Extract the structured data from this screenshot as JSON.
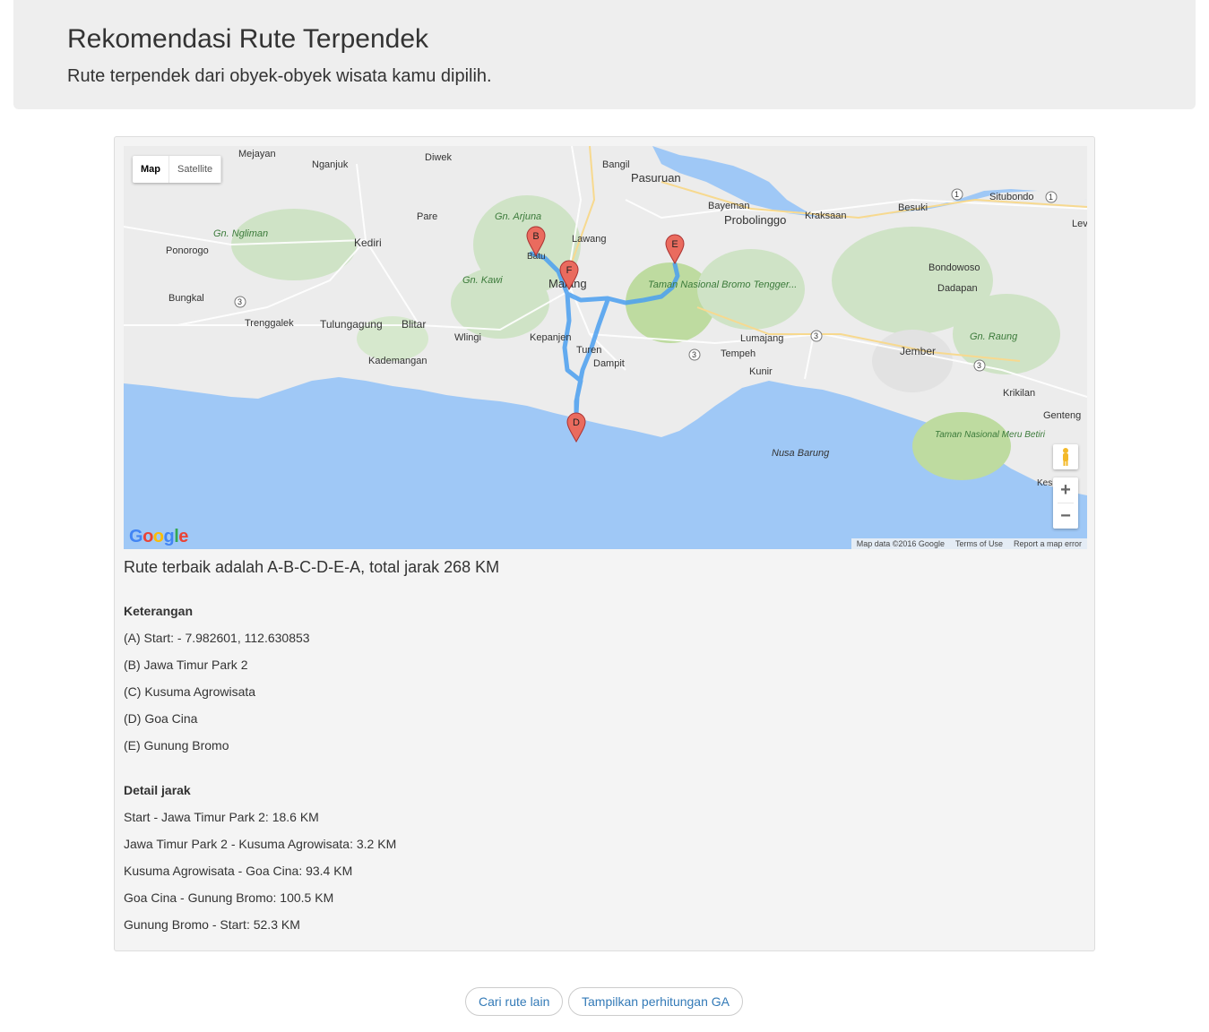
{
  "header": {
    "title": "Rekomendasi Rute Terpendek",
    "subtitle": "Rute terpendek dari obyek-obyek wisata kamu dipilih."
  },
  "map": {
    "type_controls": [
      "Map",
      "Satellite"
    ],
    "active_type": "Map",
    "logo": "Google",
    "attribution": [
      "Map data ©2016 Google",
      "Terms of Use",
      "Report a map error"
    ],
    "markers": [
      "B",
      "F",
      "E",
      "D"
    ],
    "route_color": "#4a9ff0",
    "marker_color": "#ea6b5e",
    "water_color": "#9fc8f6",
    "land_color": "#ececec",
    "places": {
      "mejayan": "Mejayan",
      "nganjuk": "Nganjuk",
      "diwek": "Diwek",
      "bangil": "Bangil",
      "pasuruan": "Pasuruan",
      "situbondo": "Situbondo",
      "bayeman": "Bayeman",
      "probolinggo": "Probolinggo",
      "kraksaan": "Kraksaan",
      "besuki": "Besuki",
      "lev": "Lev",
      "pare": "Pare",
      "arjuna": "Gn. Arjuna",
      "ngliman": "Gn. Ngliman",
      "kediri": "Kediri",
      "ponorogo": "Ponorogo",
      "lawang": "Lawang",
      "batu": "Batu",
      "kawi": "Gn. Kawi",
      "malang": "Malang",
      "taman_bromo": "Taman Nasional Bromo Tengger...",
      "bondowoso": "Bondowoso",
      "dadapan": "Dadapan",
      "bungkal": "Bungkal",
      "trenggalek": "Trenggalek",
      "tulungagung": "Tulungagung",
      "blitar": "Blitar",
      "wlingi": "Wlingi",
      "kepanjen": "Kepanjen",
      "turen": "Turen",
      "dampit": "Dampit",
      "lumajang": "Lumajang",
      "tempeh": "Tempeh",
      "kunir": "Kunir",
      "jember": "Jember",
      "raung": "Gn. Raung",
      "kademangan": "Kademangan",
      "krikilan": "Krikilan",
      "genteng": "Genteng",
      "nusa_barung": "Nusa Barung",
      "taman_meru": "Taman Nasional Meru Betiri",
      "kesilir": "Kes...gra",
      "road_3": "3",
      "road_1": "1"
    }
  },
  "summary": "Rute terbaik adalah A-B-C-D-E-A, total jarak 268 KM",
  "keterangan": {
    "title": "Keterangan",
    "items": [
      "(A) Start: - 7.982601, 112.630853",
      "(B) Jawa Timur Park 2",
      "(C) Kusuma Agrowisata",
      "(D) Goa Cina",
      "(E) Gunung Bromo"
    ]
  },
  "detail": {
    "title": "Detail jarak",
    "items": [
      "Start - Jawa Timur Park 2: 18.6 KM",
      "Jawa Timur Park 2 - Kusuma Agrowisata: 3.2 KM",
      "Kusuma Agrowisata - Goa Cina: 93.4 KM",
      "Goa Cina - Gunung Bromo: 100.5 KM",
      "Gunung Bromo - Start: 52.3 KM"
    ]
  },
  "buttons": {
    "other_route": "Cari rute lain",
    "show_ga": "Tampilkan perhitungan GA"
  }
}
